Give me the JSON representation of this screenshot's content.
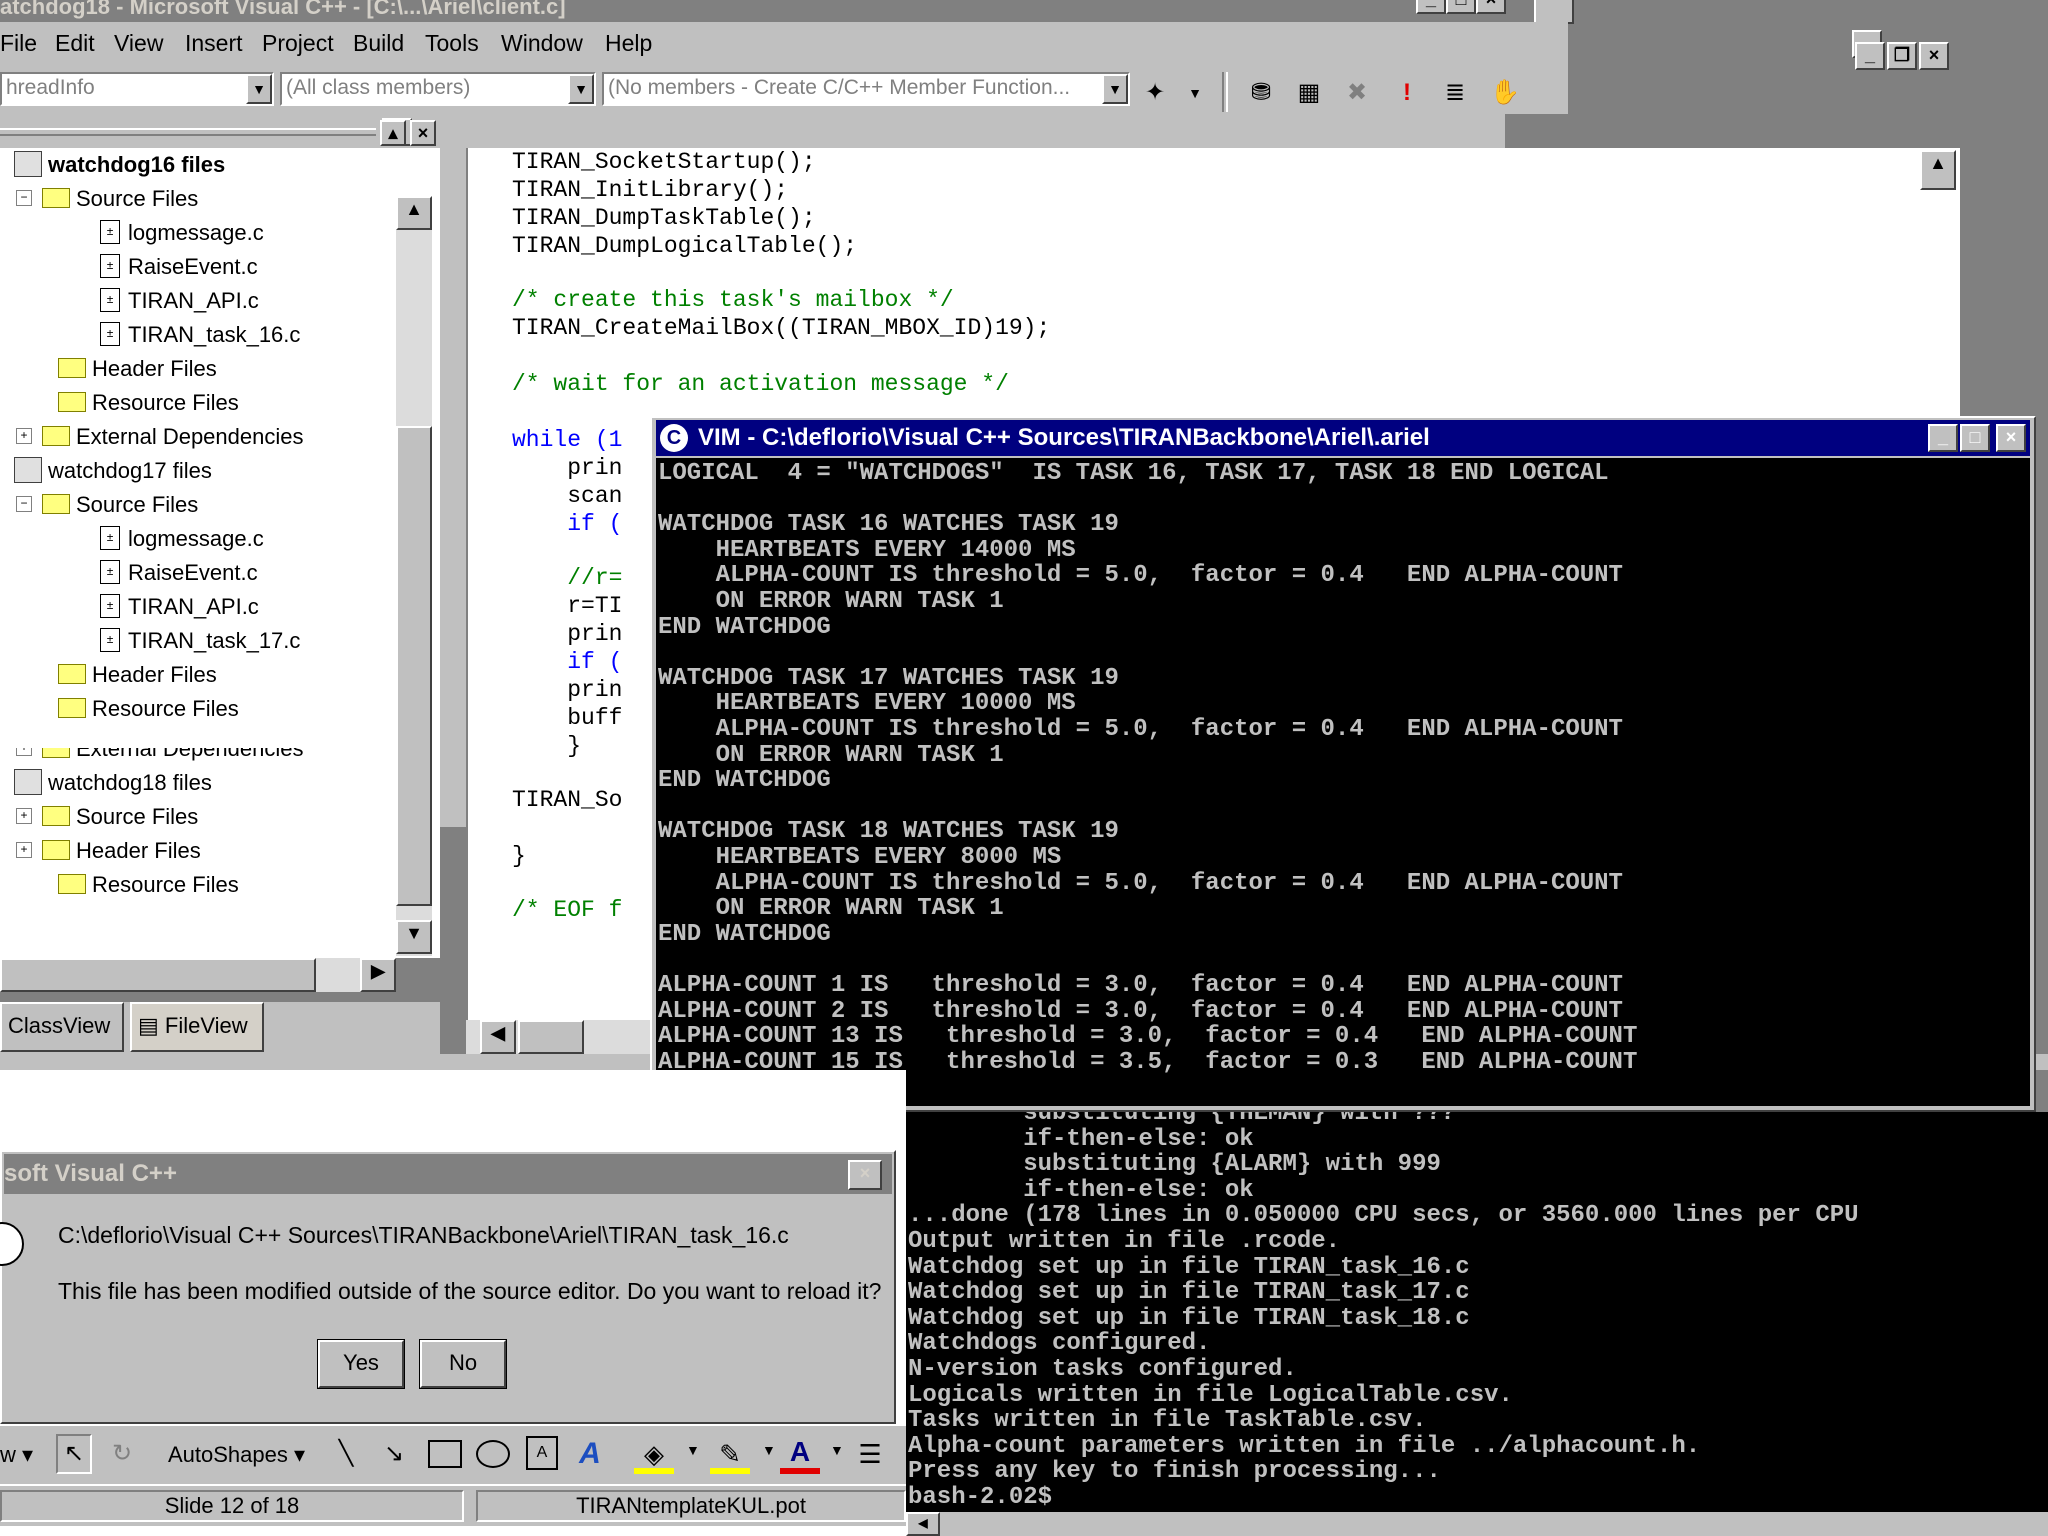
{
  "vc": {
    "title": "atchdog18 - Microsoft Visual C++ - [C:\\...\\Ariel\\client.c]",
    "menu": [
      "File",
      "Edit",
      "View",
      "Insert",
      "Project",
      "Build",
      "Tools",
      "Window",
      "Help"
    ],
    "combos": {
      "class": "hreadInfo",
      "filter": "(All class members)",
      "members": "(No members - Create C/C++ Member Function..."
    }
  },
  "workspace": {
    "rows": [
      {
        "label": "watchdog16 files",
        "type": "project",
        "bold": true
      },
      {
        "label": "Source Files",
        "type": "folder"
      },
      {
        "label": "logmessage.c",
        "type": "file"
      },
      {
        "label": "RaiseEvent.c",
        "type": "file"
      },
      {
        "label": "TIRAN_API.c",
        "type": "file"
      },
      {
        "label": "TIRAN_task_16.c",
        "type": "file"
      },
      {
        "label": "Header Files",
        "type": "folder"
      },
      {
        "label": "Resource Files",
        "type": "folder"
      },
      {
        "label": "External Dependencies",
        "type": "folder"
      },
      {
        "label": "watchdog17 files",
        "type": "project"
      },
      {
        "label": "Source Files",
        "type": "folder"
      },
      {
        "label": "logmessage.c",
        "type": "file"
      },
      {
        "label": "RaiseEvent.c",
        "type": "file"
      },
      {
        "label": "TIRAN_API.c",
        "type": "file"
      },
      {
        "label": "TIRAN_task_17.c",
        "type": "file"
      },
      {
        "label": "Header Files",
        "type": "folder"
      },
      {
        "label": "Resource Files",
        "type": "folder"
      },
      {
        "label": "External Dependencies",
        "type": "folder"
      },
      {
        "label": "watchdog18 files",
        "type": "project"
      },
      {
        "label": "Source Files",
        "type": "folder"
      },
      {
        "label": "Header Files",
        "type": "folder"
      },
      {
        "label": "Resource Files",
        "type": "folder"
      }
    ],
    "tabs": [
      "ClassView",
      "FileView"
    ]
  },
  "editor": {
    "lines": [
      "TIRAN_SocketStartup();",
      "TIRAN_InitLibrary();",
      "TIRAN_DumpTaskTable();",
      "TIRAN_DumpLogicalTable();",
      "/* create this task's mailbox */",
      "TIRAN_CreateMailBox((TIRAN_MBOX_ID)19);",
      "/* wait for an activation message */",
      "while (1",
      "    prin",
      "    scan",
      "    if (",
      "    //r=",
      "    r=TI",
      "    prin",
      "    if (",
      "    prin",
      "    buff",
      "    }",
      "TIRAN_So",
      "}",
      "/* EOF f"
    ]
  },
  "vim": {
    "title": "VIM - C:\\deflorio\\Visual C++ Sources\\TIRANBackbone\\Ariel\\.ariel",
    "lines": [
      "LOGICAL  4 = \"WATCHDOGS\"  IS TASK 16, TASK 17, TASK 18 END LOGICAL",
      "",
      "WATCHDOG TASK 16 WATCHES TASK 19",
      "    HEARTBEATS EVERY 14000 MS",
      "    ALPHA-COUNT IS threshold = 5.0,  factor = 0.4   END ALPHA-COUNT",
      "    ON ERROR WARN TASK 1",
      "END WATCHDOG",
      "",
      "WATCHDOG TASK 17 WATCHES TASK 19",
      "    HEARTBEATS EVERY 10000 MS",
      "    ALPHA-COUNT IS threshold = 5.0,  factor = 0.4   END ALPHA-COUNT",
      "    ON ERROR WARN TASK 1",
      "END WATCHDOG",
      "",
      "WATCHDOG TASK 18 WATCHES TASK 19",
      "    HEARTBEATS EVERY 8000 MS",
      "    ALPHA-COUNT IS threshold = 5.0,  factor = 0.4   END ALPHA-COUNT",
      "    ON ERROR WARN TASK 1",
      "END WATCHDOG",
      "",
      "ALPHA-COUNT 1 IS   threshold = 3.0,  factor = 0.4   END ALPHA-COUNT",
      "ALPHA-COUNT 2 IS   threshold = 3.0,  factor = 0.4   END ALPHA-COUNT",
      "ALPHA-COUNT 13 IS   threshold = 3.0,  factor = 0.4   END ALPHA-COUNT",
      "ALPHA-COUNT 15 IS   threshold = 3.5,  factor = 0.3   END ALPHA-COUNT"
    ]
  },
  "bash": {
    "lines": [
      "        substituting {THEMAN} with ???",
      "        if-then-else: ok",
      "        substituting {ALARM} with 999",
      "        if-then-else: ok",
      "...done (178 lines in 0.050000 CPU secs, or 3560.000 lines per CPU",
      "Output written in file .rcode.",
      "Watchdog set up in file TIRAN_task_16.c",
      "Watchdog set up in file TIRAN_task_17.c",
      "Watchdog set up in file TIRAN_task_18.c",
      "Watchdogs configured.",
      "N-version tasks configured.",
      "Logicals written in file LogicalTable.csv.",
      "Tasks written in file TaskTable.csv.",
      "Alpha-count parameters written in file ../alphacount.h.",
      "Press any key to finish processing...",
      "bash-2.02$"
    ]
  },
  "dialog": {
    "title": "soft Visual C++",
    "path": "C:\\deflorio\\Visual C++ Sources\\TIRANBackbone\\Ariel\\TIRAN_task_16.c",
    "message": "This file has been modified outside of the source editor. Do you want to reload it?",
    "yes": "Yes",
    "no": "No"
  },
  "ppt": {
    "draw_label": "w",
    "autoshapes": "AutoShapes",
    "slide": "Slide 12 of 18",
    "template": "TIRANtemplateKUL.pot"
  }
}
